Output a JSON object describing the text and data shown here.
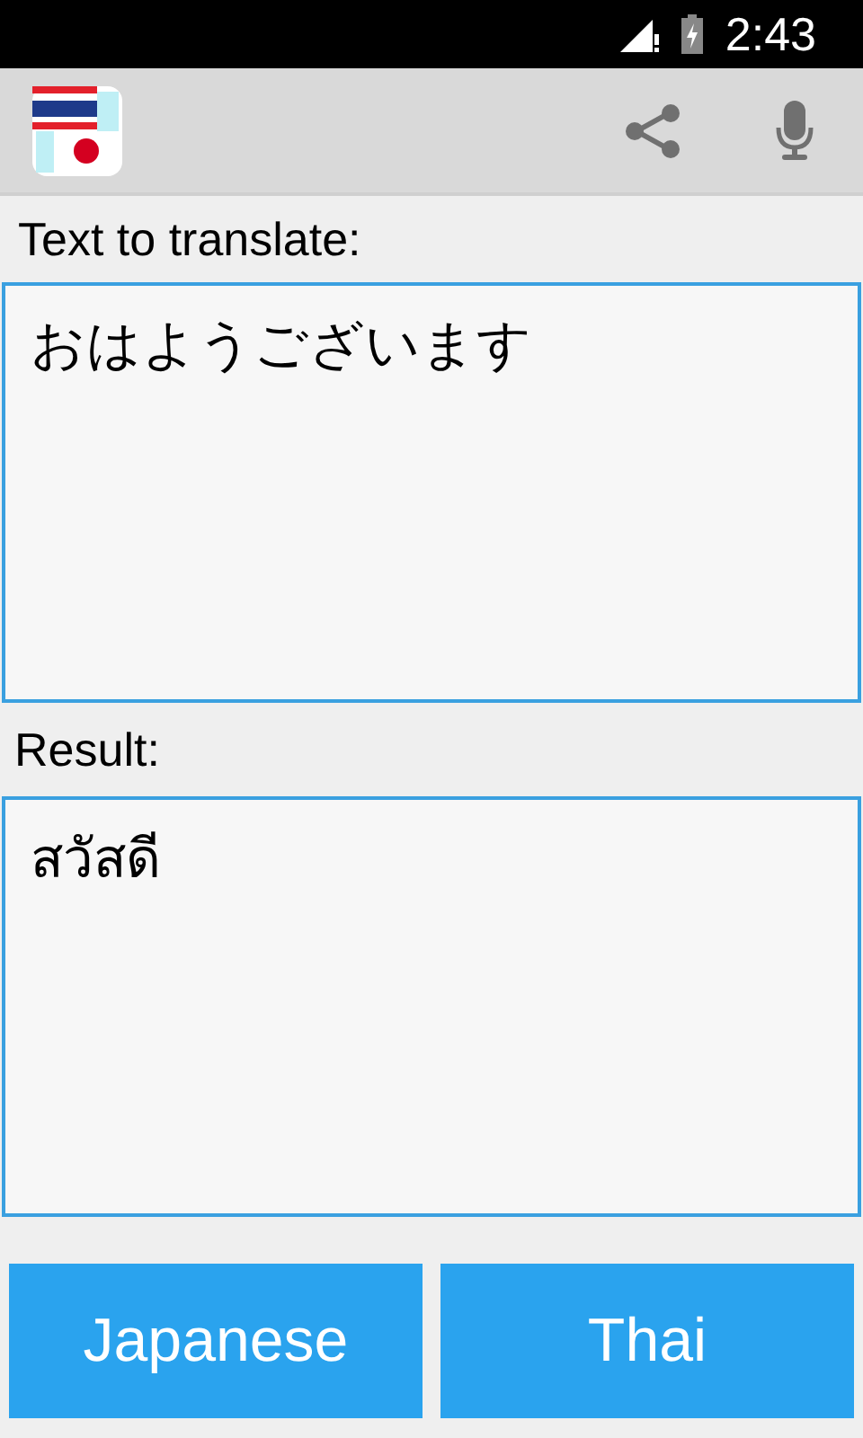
{
  "status_bar": {
    "time": "2:43"
  },
  "input": {
    "label": "Text to translate:",
    "value": "おはようございます"
  },
  "result": {
    "label": "Result:",
    "value": "สวัสดี"
  },
  "language_buttons": [
    {
      "label": "Japanese"
    },
    {
      "label": "Thai"
    }
  ]
}
